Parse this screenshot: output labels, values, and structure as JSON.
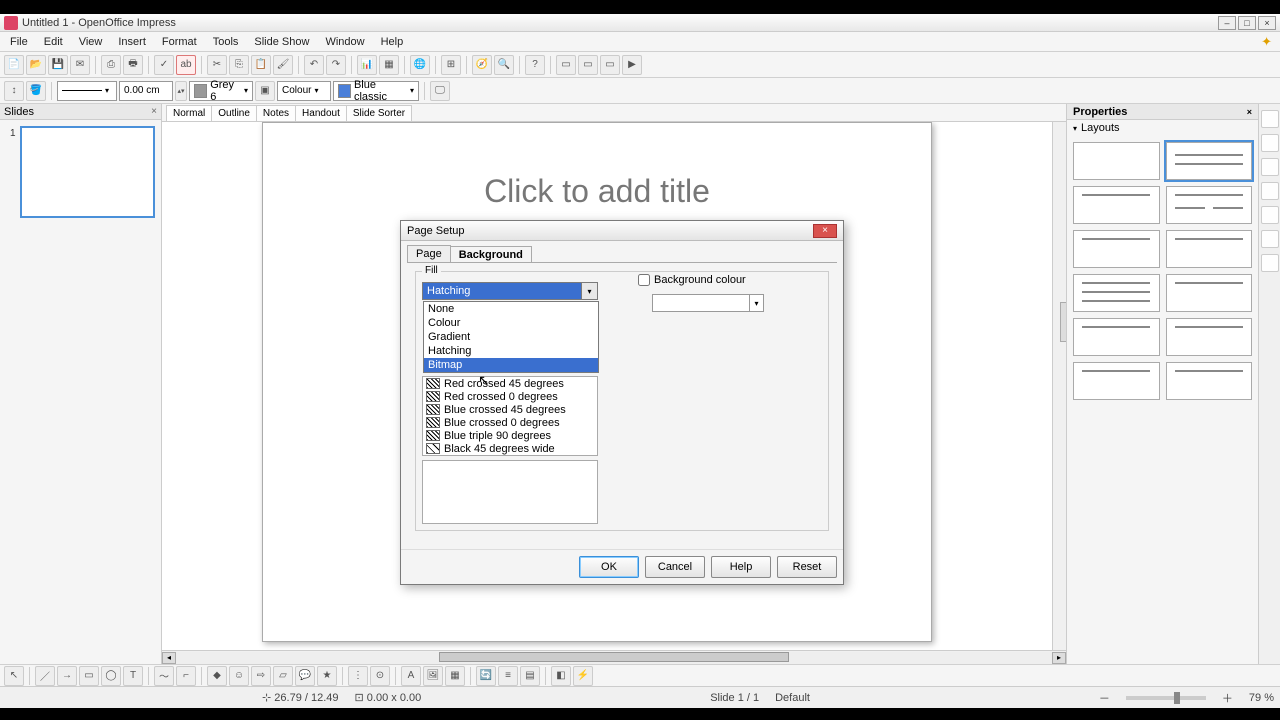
{
  "window": {
    "title": "Untitled 1 - OpenOffice Impress"
  },
  "menubar": [
    "File",
    "Edit",
    "View",
    "Insert",
    "Format",
    "Tools",
    "Slide Show",
    "Window",
    "Help"
  ],
  "toolbar2": {
    "linewidth": "0.00 cm",
    "linecolor_label": "Grey 6",
    "fillmode": "Colour",
    "fillcolor": "Blue classic"
  },
  "slides_panel": {
    "title": "Slides",
    "thumb_number": "1"
  },
  "view_tabs": [
    "Normal",
    "Outline",
    "Notes",
    "Handout",
    "Slide Sorter"
  ],
  "slide": {
    "title_placeholder": "Click to add title"
  },
  "properties": {
    "title": "Properties",
    "section_layouts": "Layouts"
  },
  "dialog": {
    "title": "Page Setup",
    "tabs": [
      "Page",
      "Background"
    ],
    "fill_label": "Fill",
    "combo_selected": "Hatching",
    "dropdown_options": [
      "None",
      "Colour",
      "Gradient",
      "Hatching",
      "Bitmap"
    ],
    "dropdown_hover": "Bitmap",
    "pattern_list": [
      "Red crossed 45 degrees",
      "Red crossed 0 degrees",
      "Blue crossed 45 degrees",
      "Blue crossed 0 degrees",
      "Blue triple 90 degrees",
      "Black 45 degrees wide"
    ],
    "bg_colour_label": "Background colour",
    "buttons": {
      "ok": "OK",
      "cancel": "Cancel",
      "help": "Help",
      "reset": "Reset"
    }
  },
  "statusbar": {
    "coords": "26.79 / 12.49",
    "size": "0.00 x 0.00",
    "slide": "Slide 1 / 1",
    "style": "Default",
    "zoom": "79 %"
  }
}
